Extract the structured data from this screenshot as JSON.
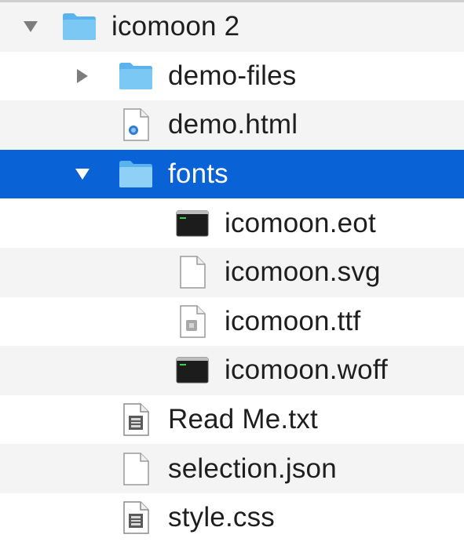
{
  "items": [
    {
      "label": "icomoon 2",
      "kind": "folder",
      "expanded": true
    },
    {
      "label": "demo-files",
      "kind": "folder",
      "expanded": false
    },
    {
      "label": "demo.html",
      "kind": "html-file"
    },
    {
      "label": "fonts",
      "kind": "folder",
      "expanded": true,
      "selected": true
    },
    {
      "label": "icomoon.eot",
      "kind": "terminal-file"
    },
    {
      "label": "icomoon.svg",
      "kind": "blank-file"
    },
    {
      "label": "icomoon.ttf",
      "kind": "font-file"
    },
    {
      "label": "icomoon.woff",
      "kind": "terminal-file"
    },
    {
      "label": "Read Me.txt",
      "kind": "text-file"
    },
    {
      "label": "selection.json",
      "kind": "blank-file"
    },
    {
      "label": "style.css",
      "kind": "text-file"
    }
  ],
  "colors": {
    "selection": "#0a63d6",
    "folder": "#6cc0f3",
    "stripe": "#f4f4f4"
  }
}
